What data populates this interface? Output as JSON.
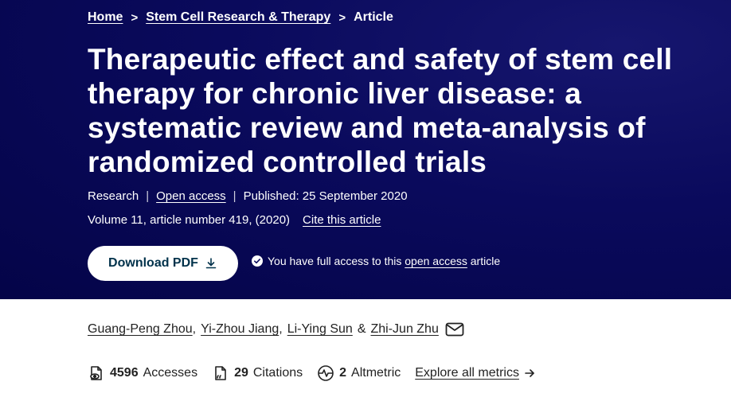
{
  "breadcrumb": {
    "home": "Home",
    "journal": "Stem Cell Research & Therapy",
    "current": "Article",
    "separator": ">"
  },
  "article": {
    "title": "Therapeutic effect and safety of stem cell therapy for chronic liver disease: a systematic review and meta-analysis of randomized controlled trials",
    "type": "Research",
    "access": "Open access",
    "published": "Published: 25 September 2020",
    "volume": "Volume 11, article number 419, (2020)",
    "cite_label": "Cite this article"
  },
  "actions": {
    "download_label": "Download PDF",
    "access_note_prefix": "You have full access to this",
    "access_note_link": "open access",
    "access_note_suffix": "article"
  },
  "authors": {
    "list": [
      "Guang-Peng Zhou",
      "Yi-Zhou Jiang",
      "Li-Ying Sun",
      "Zhi-Jun Zhu"
    ],
    "separator": ",",
    "and": "&"
  },
  "metrics": {
    "accesses_value": "4596",
    "accesses_label": "Accesses",
    "citations_value": "29",
    "citations_label": "Citations",
    "altmetric_value": "2",
    "altmetric_label": "Altmetric",
    "explore_label": "Explore all metrics"
  },
  "colors": {
    "hero_bg": "#0a0a5c",
    "button_text": "#01324b",
    "white": "#ffffff"
  }
}
